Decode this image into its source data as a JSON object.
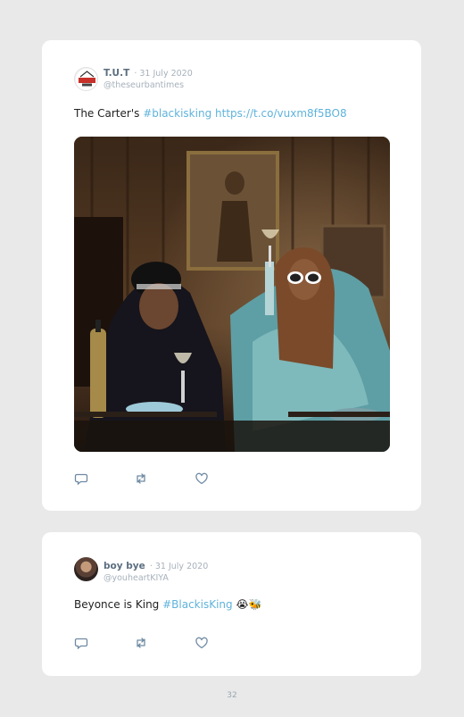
{
  "tweets": [
    {
      "author": "T.U.T",
      "date": "· 31 July 2020",
      "handle": "@theseurbantimes",
      "text_prefix": "The Carter's ",
      "hashtag": "#blackisking",
      "url": "https://t.co/vuxm8f5BO8",
      "avatar_logo_text": "URBAN TIMES",
      "image_icon": "photo-icon"
    },
    {
      "author": "boy bye",
      "date": "· 31 July 2020",
      "handle": "@youheartKIYA",
      "text_prefix": "Beyonce is King ",
      "hashtag": "#BlackisKing",
      "emoji": "😭🐝"
    }
  ],
  "actions": {
    "reply_icon": "reply-icon",
    "retweet_icon": "retweet-icon",
    "like_icon": "heart-icon"
  },
  "page_number": "32",
  "colors": {
    "link": "#5fb3dc",
    "name": "#5b6e80",
    "muted": "#a7b1bb",
    "background": "#e9e9e9"
  }
}
